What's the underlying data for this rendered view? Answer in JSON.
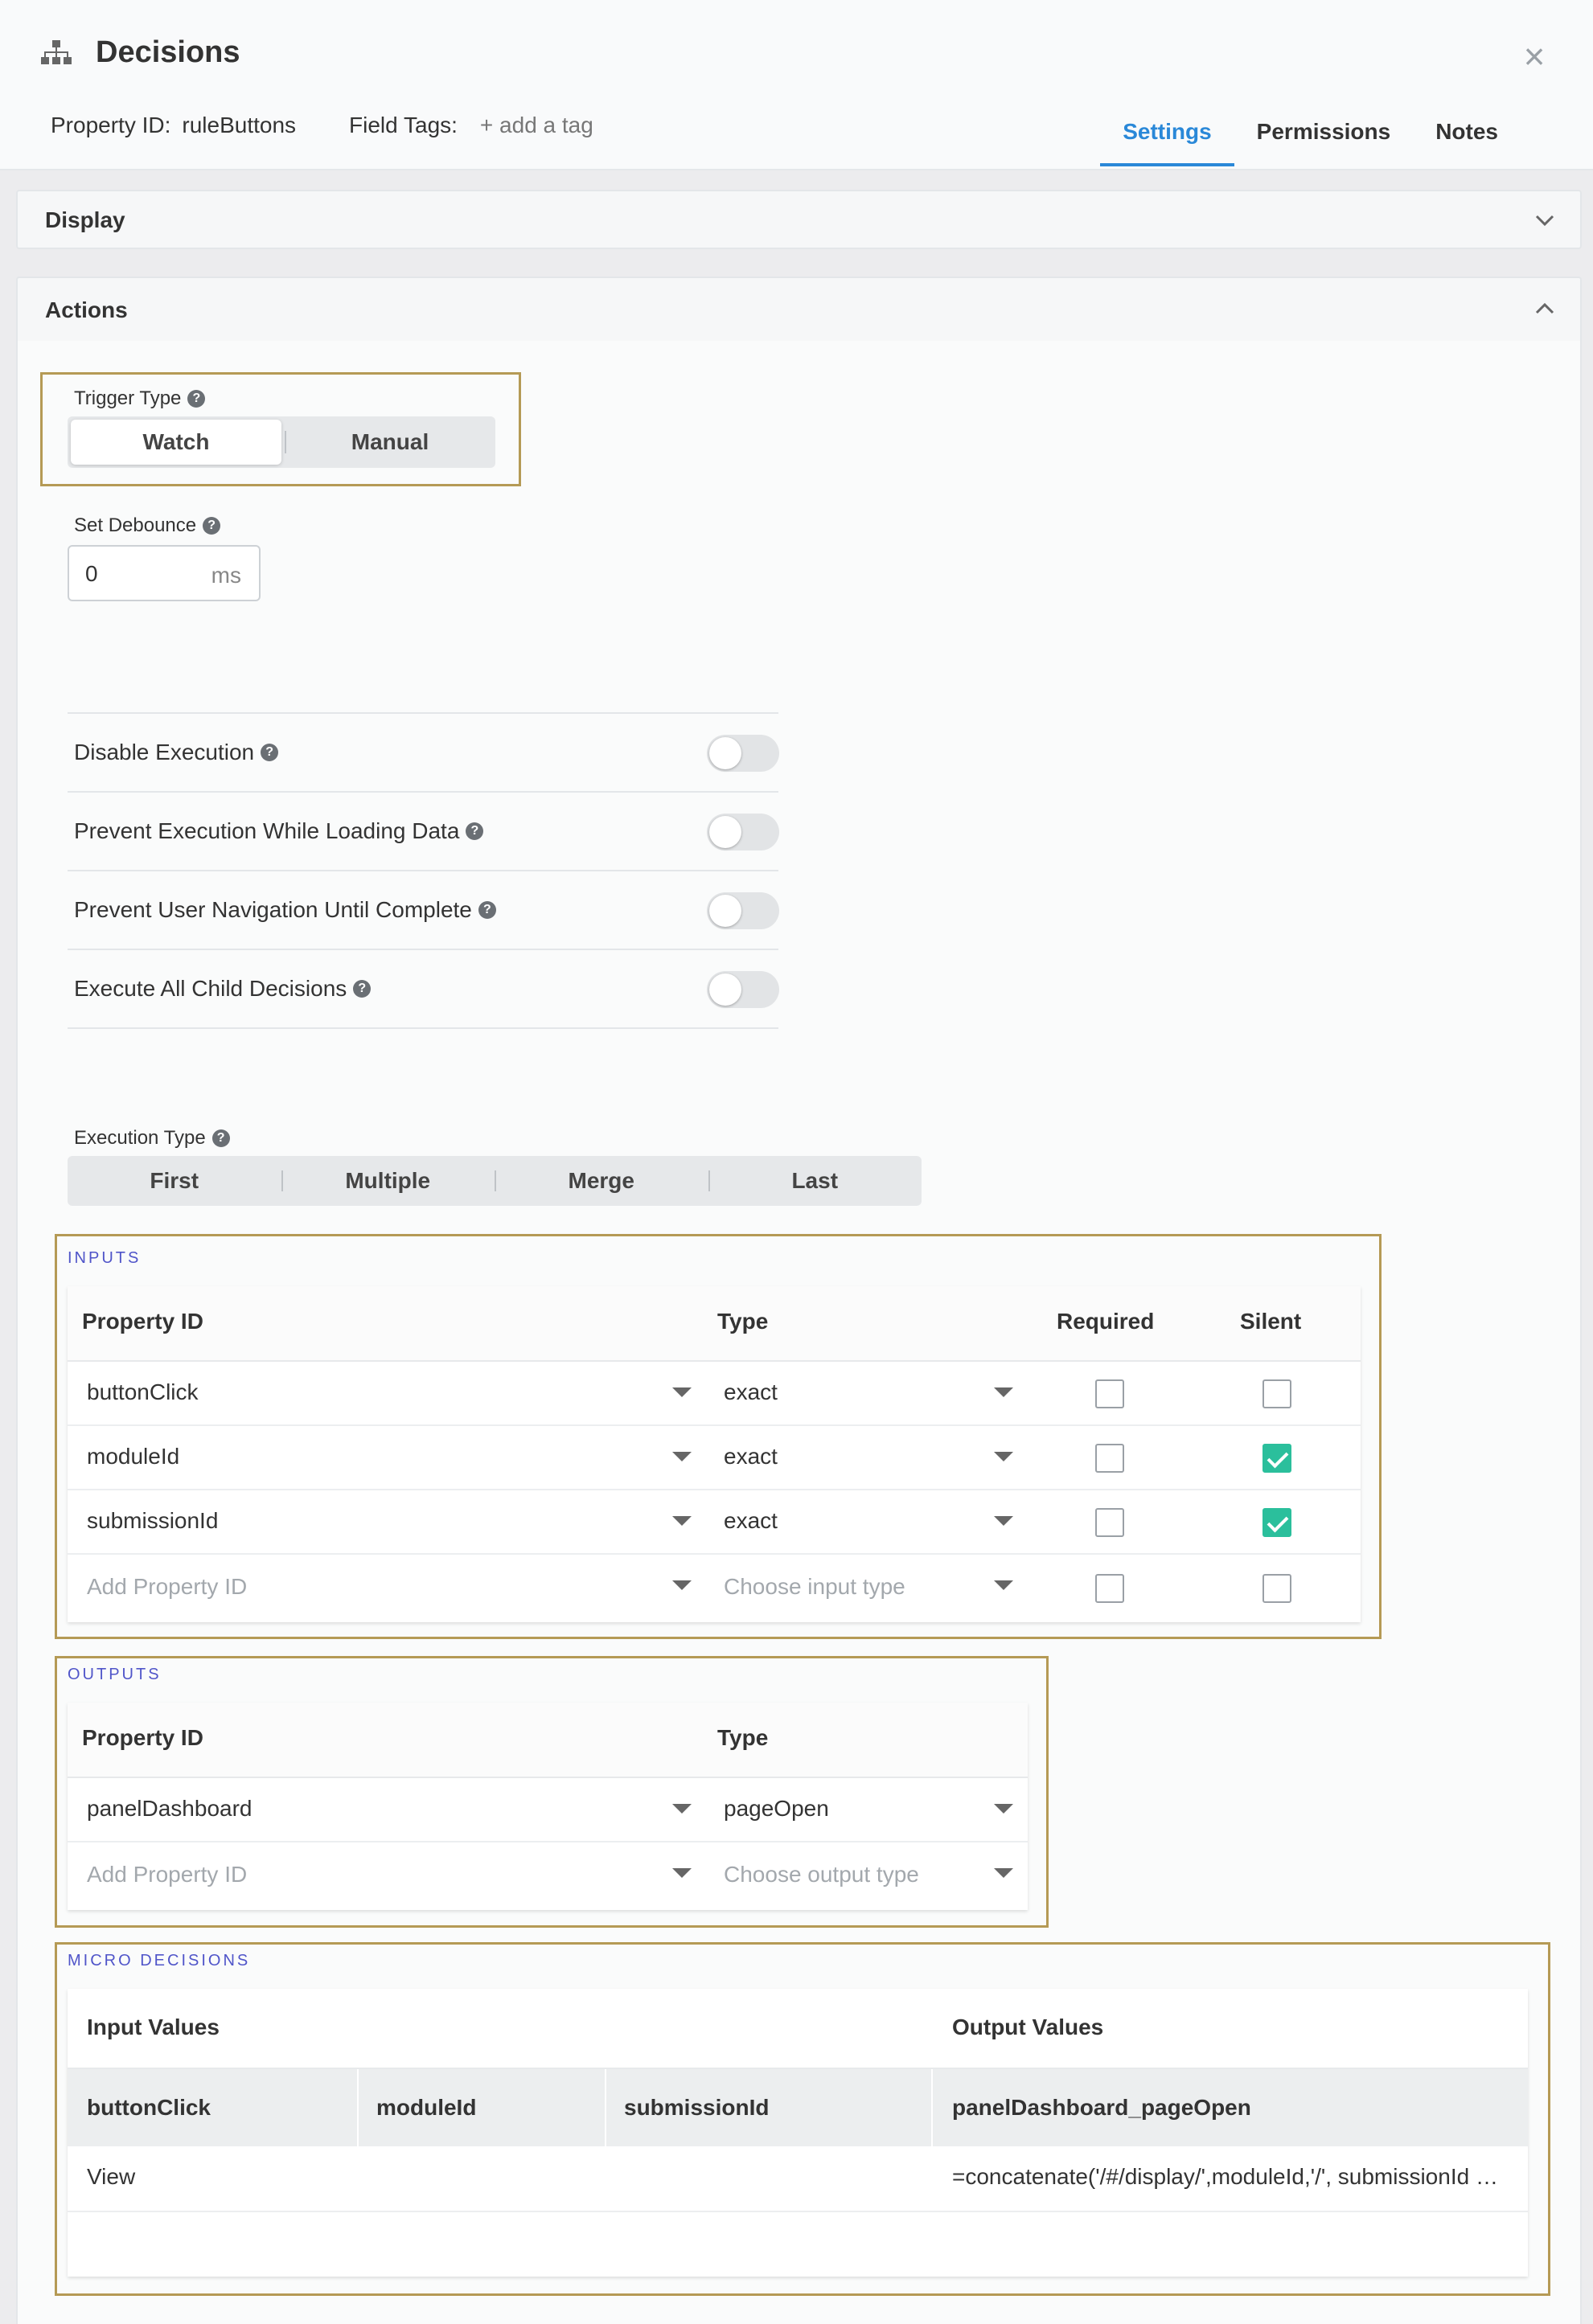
{
  "header": {
    "title": "Decisions",
    "property_id_label": "Property ID:",
    "property_id_value": "ruleButtons",
    "field_tags_label": "Field Tags:",
    "add_tag": "+ add a tag",
    "close": "×",
    "tabs": [
      {
        "label": "Settings",
        "active": true
      },
      {
        "label": "Permissions",
        "active": false
      },
      {
        "label": "Notes",
        "active": false
      }
    ]
  },
  "panels": {
    "display": "Display",
    "actions": "Actions"
  },
  "trigger": {
    "label": "Trigger Type",
    "options": [
      "Watch",
      "Manual"
    ],
    "selected": "Watch"
  },
  "debounce": {
    "label": "Set Debounce",
    "value": "0",
    "unit": "ms"
  },
  "toggles": [
    {
      "label": "Disable Execution",
      "on": false
    },
    {
      "label": "Prevent Execution While Loading Data",
      "on": false
    },
    {
      "label": "Prevent User Navigation Until Complete",
      "on": false
    },
    {
      "label": "Execute All Child Decisions",
      "on": false
    }
  ],
  "execution": {
    "label": "Execution Type",
    "options": [
      "First",
      "Multiple",
      "Merge",
      "Last"
    ]
  },
  "inputs": {
    "title": "INPUTS",
    "headers": {
      "property": "Property ID",
      "type": "Type",
      "required": "Required",
      "silent": "Silent"
    },
    "rows": [
      {
        "property": "buttonClick",
        "type": "exact",
        "required": false,
        "silent": false
      },
      {
        "property": "moduleId",
        "type": "exact",
        "required": false,
        "silent": true
      },
      {
        "property": "submissionId",
        "type": "exact",
        "required": false,
        "silent": true
      }
    ],
    "add_property_placeholder": "Add Property ID",
    "add_type_placeholder": "Choose input type"
  },
  "outputs": {
    "title": "OUTPUTS",
    "headers": {
      "property": "Property ID",
      "type": "Type"
    },
    "rows": [
      {
        "property": "panelDashboard",
        "type": "pageOpen"
      }
    ],
    "add_property_placeholder": "Add Property ID",
    "add_type_placeholder": "Choose output type"
  },
  "micro": {
    "title": "MICRO DECISIONS",
    "input_values": "Input Values",
    "output_values": "Output Values",
    "columns": [
      "buttonClick",
      "moduleId",
      "submissionId",
      "panelDashboard_pageOpen"
    ],
    "rows": [
      {
        "buttonClick": "View",
        "moduleId": "",
        "submissionId": "",
        "output": "=concatenate('/#/display/',moduleId,'/', submissionId …"
      }
    ]
  },
  "colors": {
    "accent": "#2a88d8",
    "highlight": "#b59a55",
    "check": "#2bbf9c",
    "section_title": "#5055c9"
  }
}
